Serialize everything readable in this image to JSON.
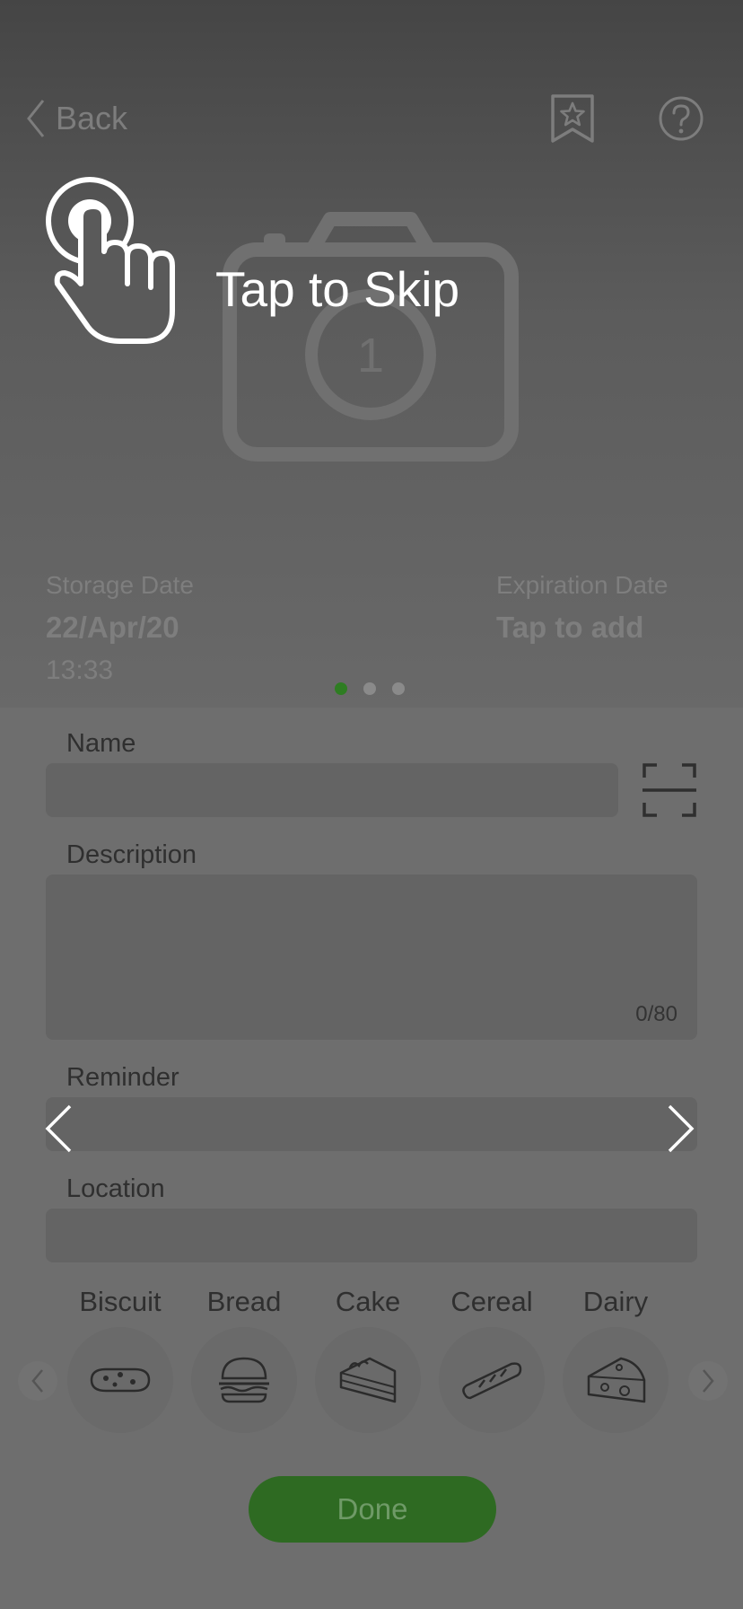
{
  "header": {
    "back_label": "Back",
    "icons": [
      "back-chevron-icon",
      "bookmark-star-icon",
      "help-icon"
    ]
  },
  "photo": {
    "placeholder_icon": "camera-icon",
    "photo_number": "1"
  },
  "overlay": {
    "icon": "tap-hand-icon",
    "text": "Tap to Skip"
  },
  "dates": {
    "storage": {
      "label": "Storage Date",
      "date": "22/Apr/20",
      "time": "13:33"
    },
    "expiration": {
      "label": "Expiration Date",
      "value": "Tap to add"
    }
  },
  "pager": {
    "count": 3,
    "active": 0
  },
  "form": {
    "name": {
      "label": "Name",
      "value": ""
    },
    "description": {
      "label": "Description",
      "value": "",
      "counter": "0/80"
    },
    "reminder": {
      "label": "Reminder",
      "value": ""
    },
    "location": {
      "label": "Location",
      "value": ""
    }
  },
  "categories": [
    {
      "label": "Biscuit",
      "icon": "biscuit-icon"
    },
    {
      "label": "Bread",
      "icon": "burger-icon"
    },
    {
      "label": "Cake",
      "icon": "cake-slice-icon"
    },
    {
      "label": "Cereal",
      "icon": "baguette-icon"
    },
    {
      "label": "Dairy",
      "icon": "cheese-icon"
    }
  ],
  "done_label": "Done",
  "colors": {
    "accent_green": "#2e7d22",
    "done_button": "#2e6a22",
    "overlay_text": "#ffffff"
  }
}
